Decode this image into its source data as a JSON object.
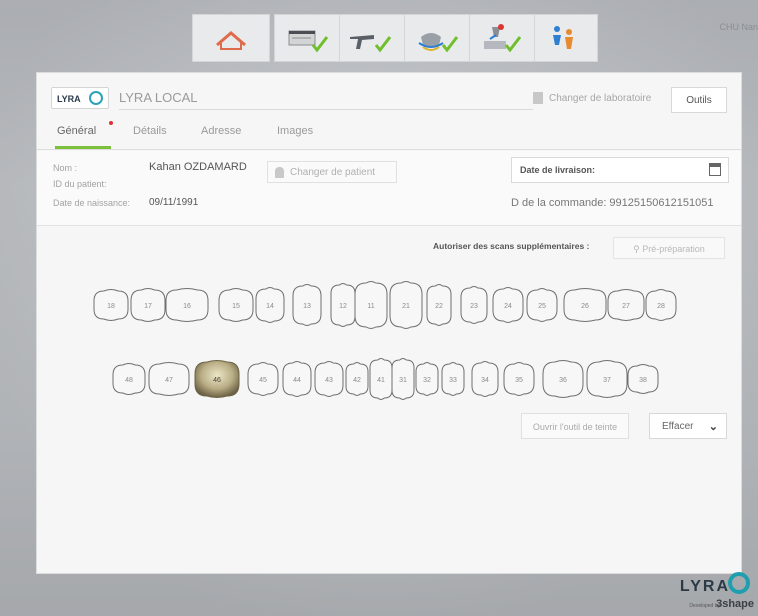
{
  "corner_label": "CHU Nan",
  "toolbar": {
    "home_icon": "house-outline-icon",
    "steps": [
      "order-form-icon",
      "scanner-icon",
      "crown-design-icon",
      "mill-icon",
      "people-icon"
    ],
    "check_color": "#6fbf2c"
  },
  "header": {
    "logo_text": "LYRA",
    "lab_name": "LYRA LOCAL",
    "change_lab": "Changer de laboratoire",
    "tools": "Outils"
  },
  "tabs": [
    "Général",
    "Détails",
    "Adresse",
    "Images"
  ],
  "patient": {
    "name_label": "Nom :",
    "name_value": "Kahan OZDAMARD",
    "id_label": "ID du patient:",
    "dob_label": "Date de naissance:",
    "dob_value": "09/11/1991",
    "change_patient": "Changer de patient",
    "delivery_label": "Date de livraison:",
    "order_text": "D de la commande: 99125150612151051"
  },
  "scans": {
    "allow_label": "Autoriser des scans supplémentaires :",
    "prep_button": "Pré-préparation"
  },
  "teeth": {
    "upper": [
      "18",
      "17",
      "16",
      "15",
      "14",
      "13",
      "12",
      "11",
      "21",
      "22",
      "23",
      "24",
      "25",
      "26",
      "27",
      "28"
    ],
    "lower": [
      "48",
      "47",
      "46",
      "45",
      "44",
      "43",
      "42",
      "41",
      "31",
      "32",
      "33",
      "34",
      "35",
      "36",
      "37",
      "38"
    ],
    "selected": "46"
  },
  "actions": {
    "shade_tool": "Ouvrir l'outil de teinte",
    "clear": "Effacer"
  },
  "brand": {
    "name": "LYRA",
    "developed_by": "Developed by",
    "vendor": "3shape"
  },
  "colors": {
    "accent_green": "#7bbf3a",
    "brand_teal": "#1e9fb0",
    "required_dot": "#dd3333"
  }
}
